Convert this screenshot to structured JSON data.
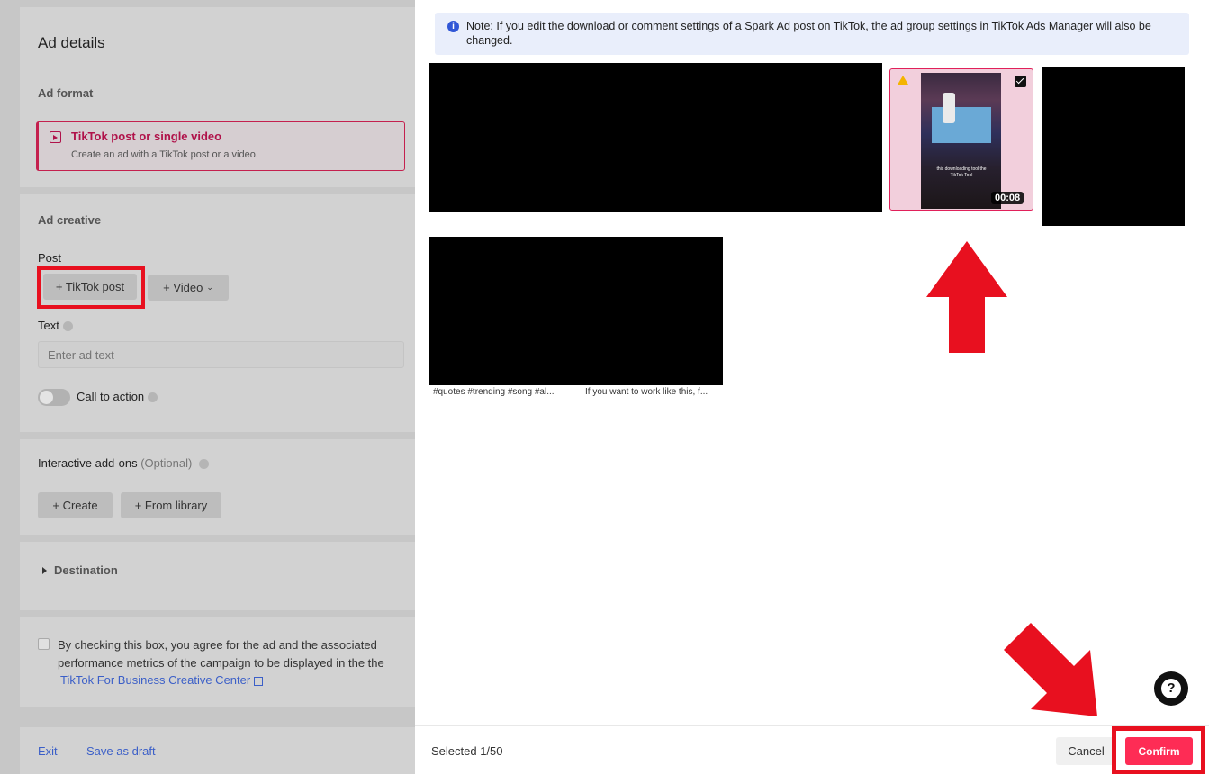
{
  "left": {
    "title": "Ad details",
    "ad_format_label": "Ad format",
    "format_card": {
      "title": "TikTok post or single video",
      "subtitle": "Create an ad with a TikTok post or a video."
    },
    "ad_creative_label": "Ad creative",
    "post_label": "Post",
    "tiktok_post_button": "+ TikTok post",
    "video_button": "+ Video",
    "text_label": "Text",
    "text_placeholder": "Enter ad text",
    "cta_label": "Call to action",
    "addons_label": "Interactive add-ons",
    "addons_optional": "(Optional)",
    "create_button": "+ Create",
    "library_button": "+ From library",
    "destination_label": "Destination",
    "consent_text": "By checking this box, you agree for the ad and the associated performance metrics of the campaign to be displayed in the the",
    "consent_link": "TikTok For Business Creative Center",
    "exit": "Exit",
    "save_draft": "Save as draft"
  },
  "modal": {
    "note_icon": "i",
    "note": "Note: If you edit the download or comment settings of a Spark Ad post on TikTok, the ad group settings in TikTok Ads Manager will also be changed.",
    "selected_video": {
      "duration": "00:08",
      "thumb_caption": "this downloading tool the TikTok Tool"
    },
    "captions": [
      "#quotes #trending #song #al...",
      "If you want to work like this, f..."
    ],
    "selected_count": "Selected 1/50",
    "cancel": "Cancel",
    "confirm": "Confirm"
  },
  "help": "?",
  "colors": {
    "accent": "#fe2c55",
    "highlight": "#e8101f",
    "link": "#3b5fc8"
  },
  "icons": [
    "video-format-icon",
    "info-icon",
    "warning-icon",
    "checkbox-checked-icon",
    "question-icon",
    "external-link-icon",
    "chevron-down-icon",
    "caret-right-icon"
  ]
}
